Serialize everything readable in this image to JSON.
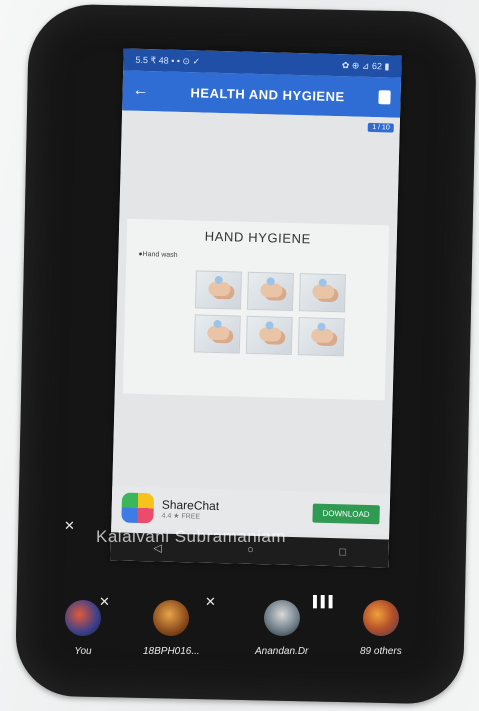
{
  "status_bar": {
    "left": "5.5 ₹ 48 • • ⊙ ✓",
    "right": "✿ ⊕ ⊿ 62 ▮"
  },
  "app_bar": {
    "back": "←",
    "title": "HEALTH AND HYGIENE"
  },
  "page_badge": "1 / 10",
  "slide": {
    "title": "HAND HYGIENE",
    "bullet": "●Hand wash",
    "steps": 6
  },
  "ad": {
    "name": "ShareChat",
    "rating": "4.4 ★ FREE",
    "button": "DOWNLOAD"
  },
  "nav": {
    "back": "◁",
    "home": "○",
    "recent": "□"
  },
  "call": {
    "speaker": "Kalaivani Subramaniam",
    "participants": [
      {
        "label": "You"
      },
      {
        "label": "18BPH016..."
      },
      {
        "label": "Anandan.Dr"
      },
      {
        "label": "89 others"
      }
    ]
  },
  "icons": {
    "mic_off": "🎙̸",
    "speaking_bars": "▌▌▌"
  }
}
